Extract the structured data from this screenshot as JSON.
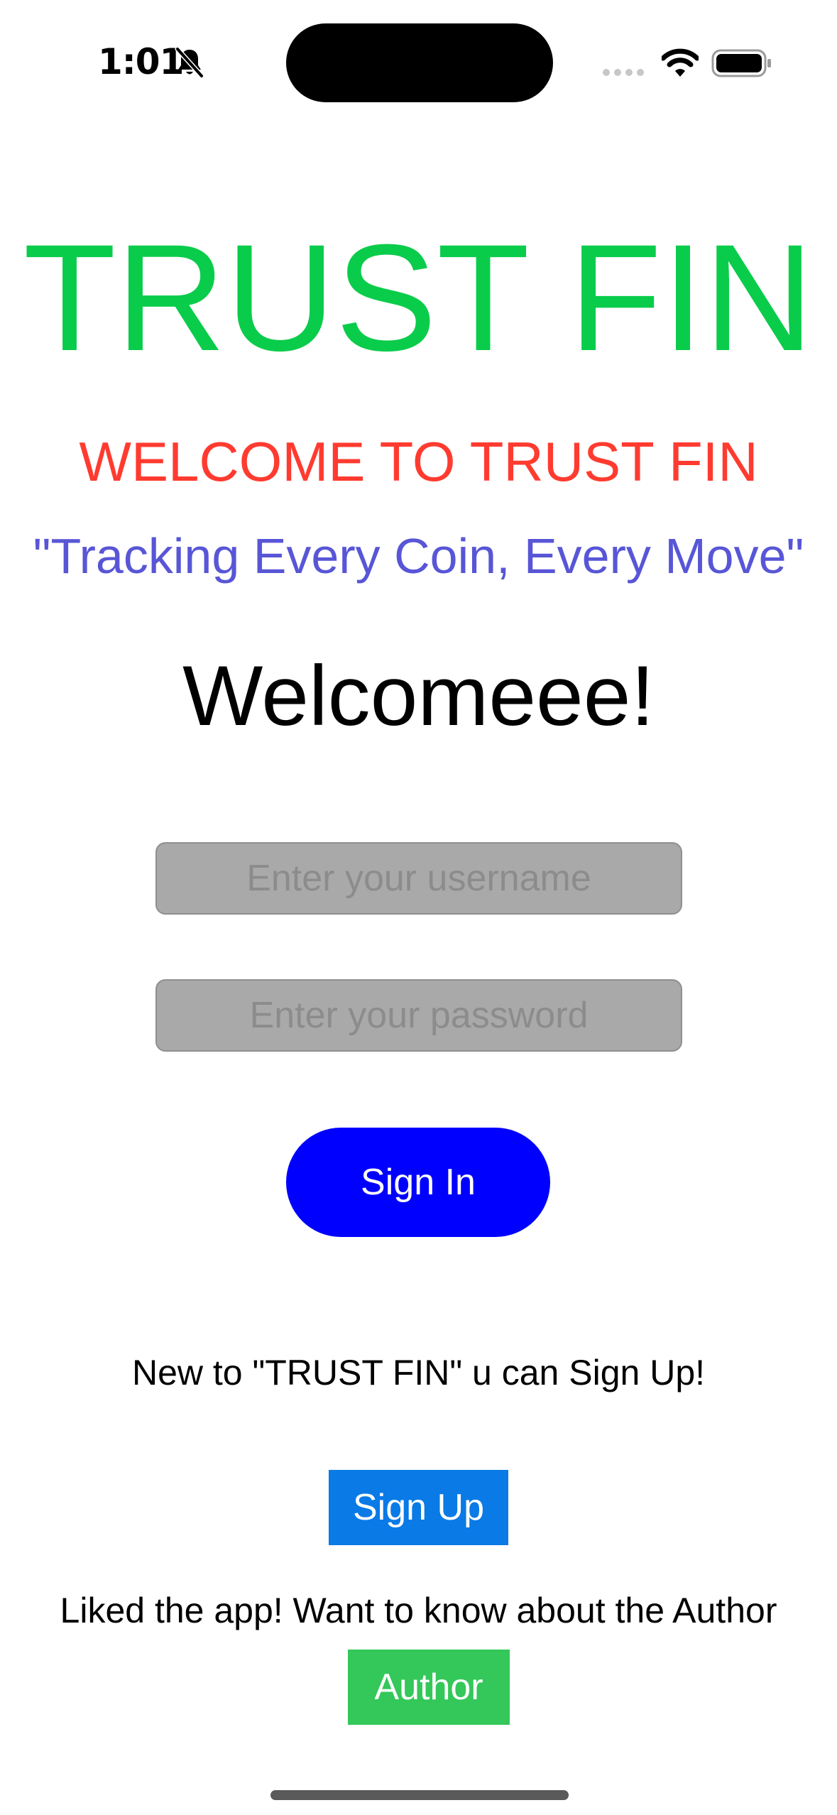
{
  "status_bar": {
    "time": "1:01",
    "icons": [
      "bell-slash-icon",
      "signal-dots-icon",
      "wifi-icon",
      "battery-icon"
    ]
  },
  "header": {
    "title": "TRUST FIN",
    "welcome": "WELCOME TO TRUST FIN",
    "tagline": "\"Tracking Every Coin, Every Move\""
  },
  "login": {
    "greeting": "Welcomeee!",
    "username_placeholder": "Enter your username",
    "username_value": "",
    "password_placeholder": "Enter your password",
    "password_value": "",
    "signin_label": "Sign In"
  },
  "signup": {
    "prompt": "New to \"TRUST FIN\" u can Sign Up!",
    "button_label": "Sign Up"
  },
  "author": {
    "prompt": "Liked the app! Want to know about the Author",
    "button_label": "Author"
  },
  "colors": {
    "title": "#0acc4b",
    "welcome": "#ff3b30",
    "tagline": "#5856d6",
    "signin_button": "#0000ff",
    "signup_button": "#0a7ae6",
    "author_button": "#34c759",
    "input_background": "#a9a9a9"
  }
}
